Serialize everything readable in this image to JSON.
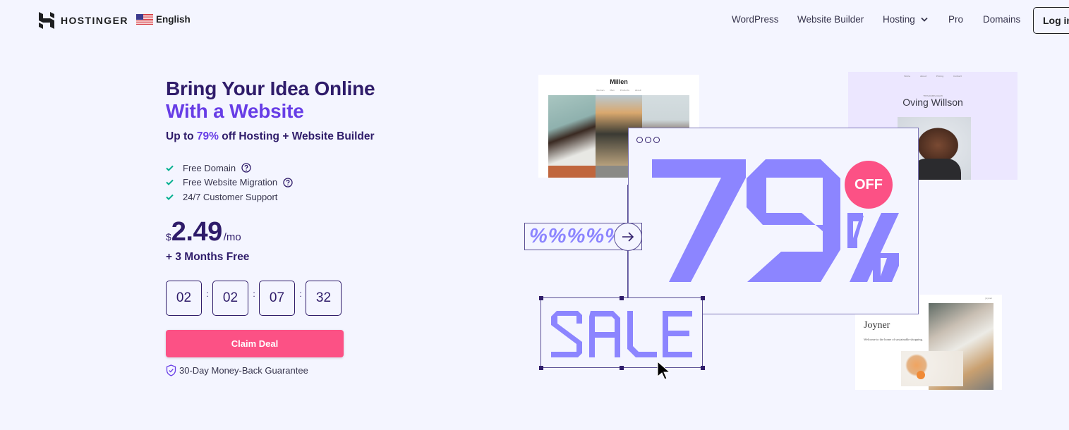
{
  "header": {
    "brand": "HOSTINGER",
    "language": "English",
    "nav": [
      {
        "label": "WordPress"
      },
      {
        "label": "Website Builder"
      },
      {
        "label": "Hosting",
        "has_dropdown": true
      },
      {
        "label": "Pro"
      },
      {
        "label": "Domains"
      }
    ],
    "login_label": "Log in"
  },
  "hero": {
    "title_line1": "Bring Your Idea Online",
    "title_line2": "With a Website",
    "subtitle_prefix": "Up to ",
    "subtitle_highlight": "79%",
    "subtitle_suffix": " off Hosting + Website Builder",
    "features": [
      {
        "label": "Free Domain",
        "has_help": true
      },
      {
        "label": "Free Website Migration",
        "has_help": true
      },
      {
        "label": "24/7 Customer Support",
        "has_help": false
      }
    ],
    "price": {
      "currency": "$",
      "amount": "2.49",
      "period": "/mo"
    },
    "bonus": "+ 3 Months Free",
    "countdown": {
      "days": "02",
      "hours": "02",
      "minutes": "07",
      "seconds": "32",
      "separator": ":"
    },
    "cta_label": "Claim Deal",
    "guarantee": "30-Day Money-Back Guarantee"
  },
  "illustration": {
    "promo_value": "79",
    "promo_badge": "OFF",
    "percent_strip": "%%%%%",
    "sale_text": "SALE",
    "templates": {
      "millen": {
        "title": "Millen",
        "nav": [
          "Women",
          "Men",
          "Products",
          "About"
        ]
      },
      "oving": {
        "title": "Oving Willson",
        "nav": [
          "Home",
          "About",
          "Pricing",
          "Contact"
        ],
        "subtitle": "THE SUCCESS COACH"
      },
      "joyner": {
        "title": "Joyner",
        "text": "Welcome to the home of sustainable shopping.",
        "brand": "Joyner"
      }
    }
  },
  "colors": {
    "background": "#f4f5ff",
    "primary_dark": "#2f1c6a",
    "accent_purple": "#673de6",
    "illustration_purple": "#8c85ff",
    "cta_pink": "#fc5185",
    "check_green": "#00b090"
  }
}
